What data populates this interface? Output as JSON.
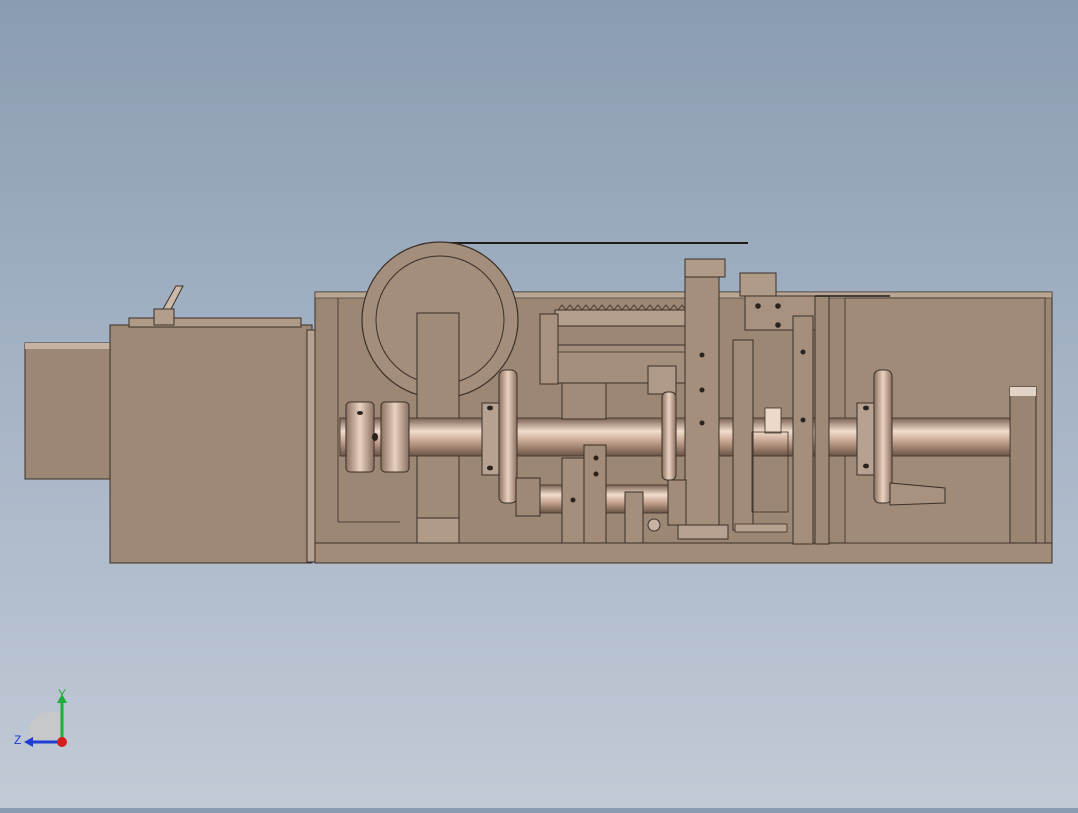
{
  "viewport": {
    "background_top": "#8a9cb2",
    "background_bottom": "#c2cad6",
    "model_color": "#a08a78"
  },
  "triad": {
    "y_label": "Y",
    "z_label": "Z",
    "y_color": "#1fae3a",
    "z_color": "#1e3ed6",
    "x_color": "#d41e1e"
  }
}
